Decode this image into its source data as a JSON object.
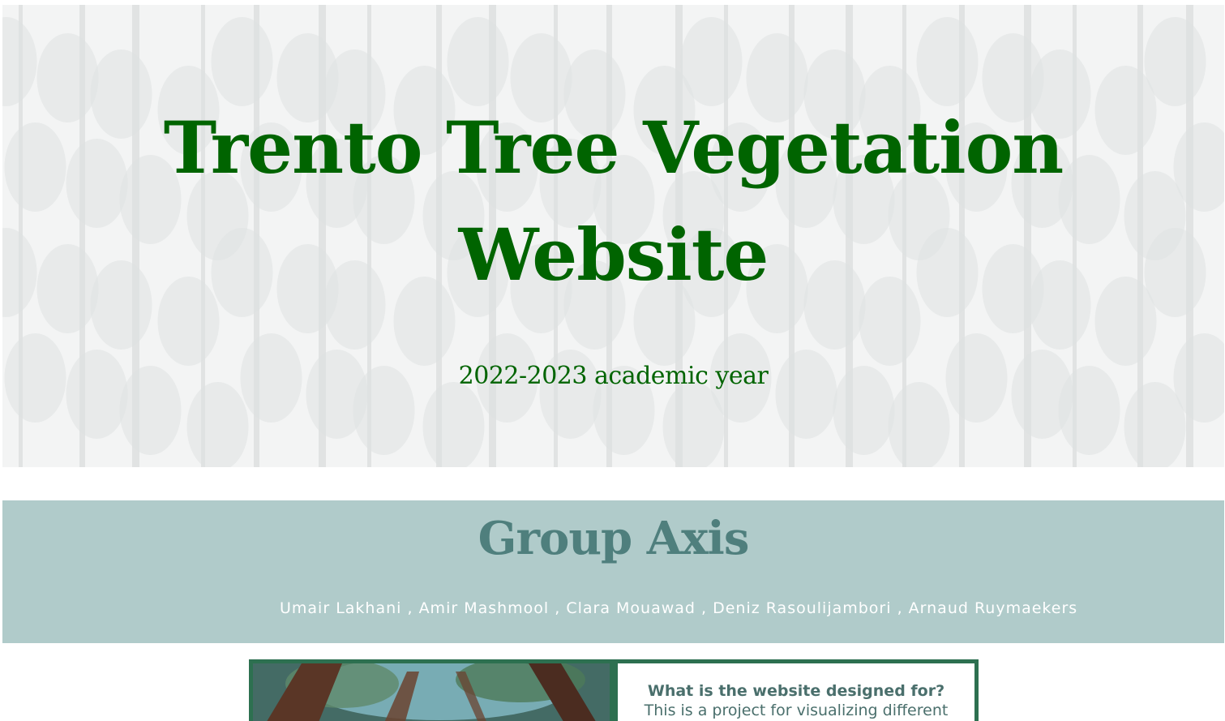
{
  "hero": {
    "title": "Trento Tree Vegetation Website",
    "subtitle": "2022-2023 academic year"
  },
  "group": {
    "title": "Group Axis",
    "members": [
      "Umair Lakhani",
      "Amir Mashmool",
      "Clara Mouawad",
      "Deniz Rasoulijambori",
      "Arnaud Ruymaekers"
    ],
    "separator": " , "
  },
  "info": {
    "question": "What is the website designed for?",
    "body": "This is a project for visualizing different"
  },
  "colors": {
    "title_green": "#006400",
    "band": "#b0cbca",
    "band_title": "#4f7f7d",
    "card_border": "#2d7050",
    "card_text": "#4a6f6c"
  }
}
